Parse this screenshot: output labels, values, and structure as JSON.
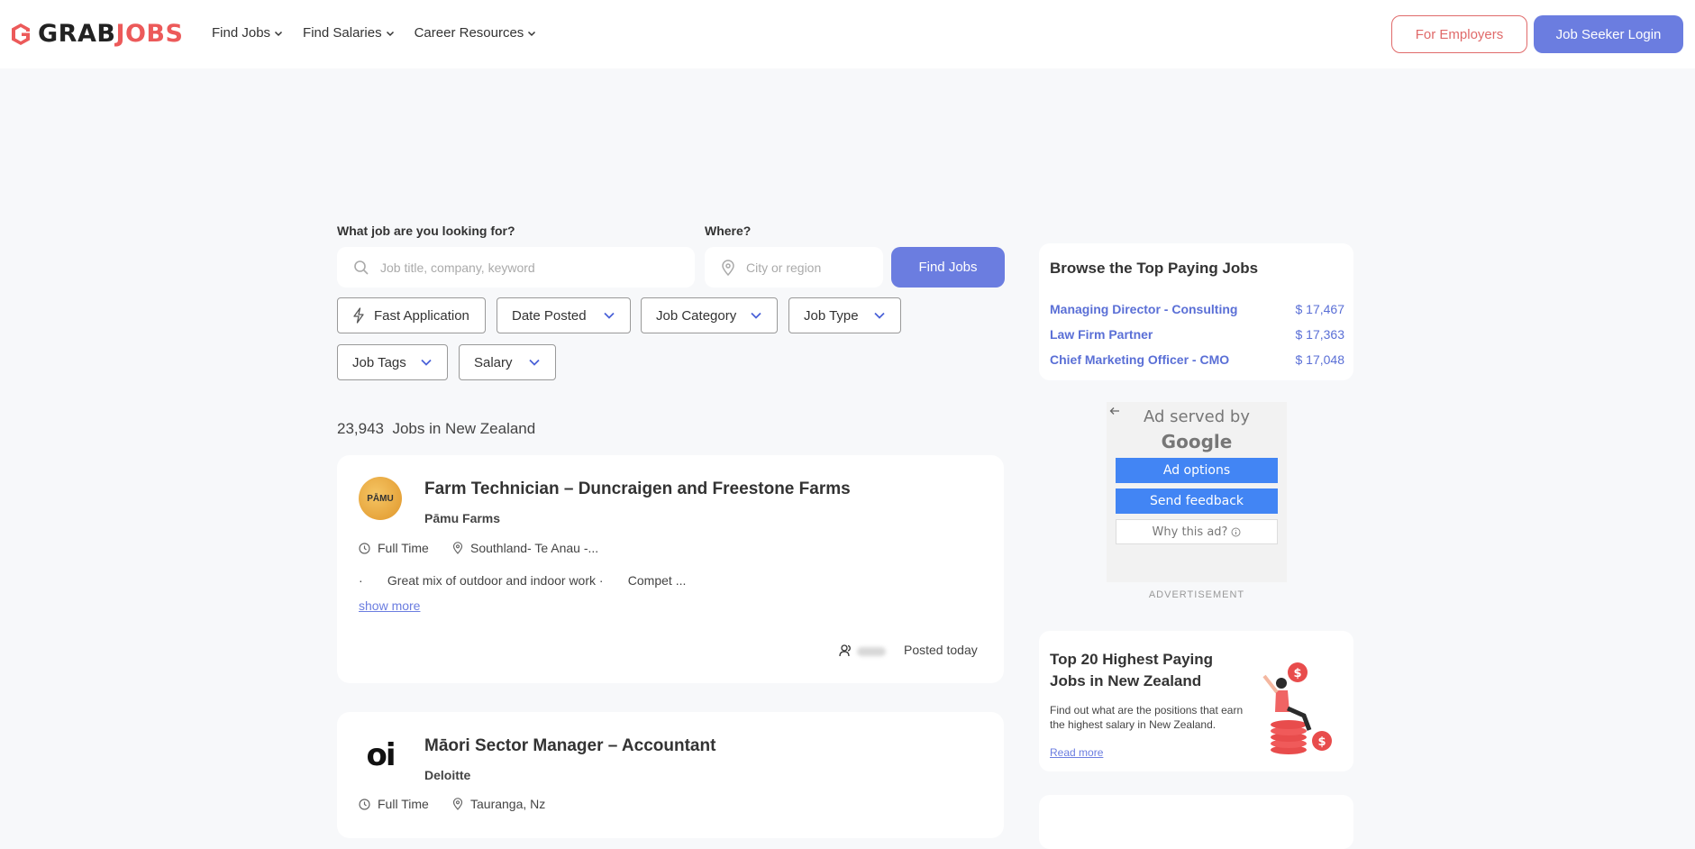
{
  "header": {
    "logo_part1": "GRAB",
    "logo_part2": "JOBS",
    "nav": [
      {
        "label": "Find Jobs"
      },
      {
        "label": "Find Salaries"
      },
      {
        "label": "Career Resources"
      }
    ],
    "employers_label": "For Employers",
    "login_label": "Job Seeker Login"
  },
  "search": {
    "what_label": "What job are you looking for?",
    "what_placeholder": "Job title, company, keyword",
    "where_label": "Where?",
    "where_placeholder": "City or region",
    "find_label": "Find Jobs"
  },
  "filters": {
    "fast_application": "Fast Application",
    "date_posted": "Date Posted",
    "job_category": "Job Category",
    "job_type": "Job Type",
    "job_tags": "Job Tags",
    "salary": "Salary"
  },
  "results": {
    "count": "23,943",
    "count_suffix": "Jobs in New Zealand"
  },
  "jobs": [
    {
      "logo_text": "PĀMU",
      "title": "Farm Technician – Duncraigen and Freestone Farms",
      "company": "Pāmu Farms",
      "type": "Full Time",
      "location": "Southland- Te Anau -...",
      "snippet": "·       Great mix of outdoor and indoor work ·       Compet ...",
      "show_more": "show more",
      "posted": "Posted today"
    },
    {
      "logo_text": "oi",
      "title": "Māori Sector Manager – Accountant",
      "company": "Deloitte",
      "type": "Full Time",
      "location": "Tauranga, Nz"
    }
  ],
  "sidebar": {
    "top_paying": {
      "title": "Browse the Top Paying Jobs",
      "items": [
        {
          "title": "Managing Director - Consulting",
          "value": "$ 17,467"
        },
        {
          "title": "Law Firm Partner",
          "value": "$ 17,363"
        },
        {
          "title": "Chief Marketing Officer - CMO",
          "value": "$ 17,048"
        }
      ]
    },
    "ad": {
      "served_by": "Ad served by",
      "google": "Google",
      "options": "Ad options",
      "feedback": "Send feedback",
      "why": "Why this ad?",
      "label": "ADVERTISEMENT"
    },
    "promo": {
      "title": "Top 20 Highest Paying Jobs in New Zealand",
      "desc": "Find out what are the positions that earn the highest salary in New Zealand.",
      "link": "Read more"
    }
  },
  "colors": {
    "brand_red": "#ec5a5a",
    "accent": "#6b7de0"
  }
}
